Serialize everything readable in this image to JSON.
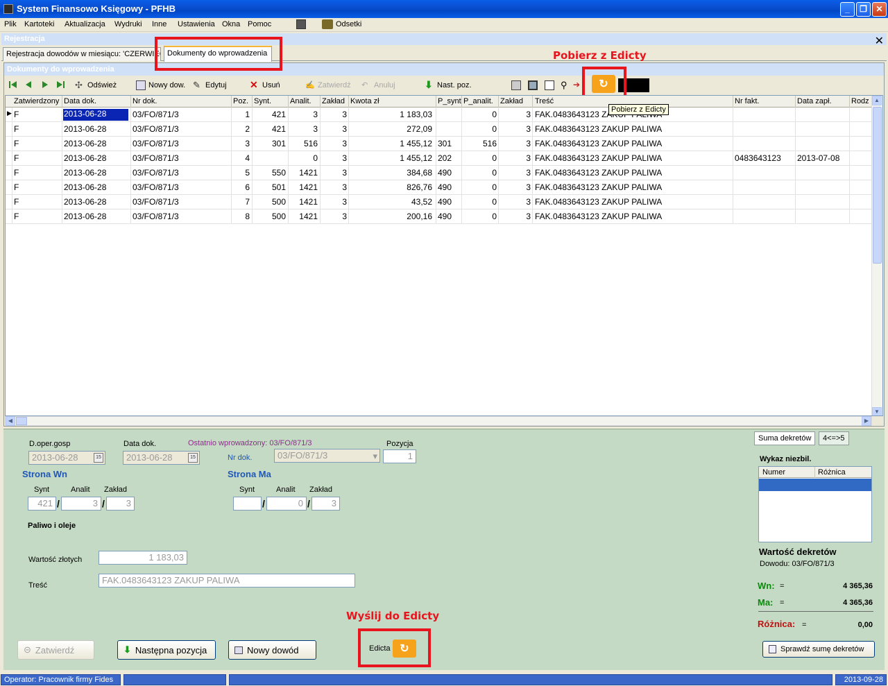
{
  "window": {
    "title": "System Finansowo Księgowy - PFHB"
  },
  "menu": [
    "Plik",
    "Kartoteki",
    "Aktualizacja",
    "Wydruki",
    "Inne",
    "Ustawienia",
    "Okna",
    "Pomoc"
  ],
  "menu_extra": {
    "odsetki": "Odsetki"
  },
  "child": {
    "title": "Rejestracja"
  },
  "tabs": [
    {
      "label": "Rejestracja dowodów w miesiącu: 'CZERWIEC'"
    },
    {
      "label": "Dokumenty do wprowadzenia"
    }
  ],
  "panel": {
    "title": "Dokumenty do wprowadzenia"
  },
  "toolbar": {
    "refresh": "Odśwież",
    "new_doc": "Nowy dow.",
    "edit": "Edytuj",
    "delete": "Usuń",
    "confirm": "Zatwierdź",
    "cancel": "Anuluj",
    "next_pos": "Nast. poz."
  },
  "annotations": {
    "fetch": "Pobierz z Edicty",
    "send": "Wyślij do Edicty",
    "tooltip": "Pobierz z Edicty"
  },
  "grid": {
    "columns": [
      "Zatwierdzony",
      "Data dok.",
      "Nr dok.",
      "Poz.",
      "Synt.",
      "Analit.",
      "Zakład",
      "Kwota zł",
      "P_synt",
      "P_analit.",
      "Zakład",
      "Treść",
      "Nr fakt.",
      "Data zapł.",
      "Rodz"
    ],
    "rows": [
      [
        "F",
        "2013-06-28",
        "03/FO/871/3",
        "1",
        "421",
        "3",
        "3",
        "1 183,03",
        "",
        "0",
        "3",
        "FAK.0483643123 ZAKUP PALIWA",
        "",
        "",
        ""
      ],
      [
        "F",
        "2013-06-28",
        "03/FO/871/3",
        "2",
        "421",
        "3",
        "3",
        "272,09",
        "",
        "0",
        "3",
        "FAK.0483643123 ZAKUP PALIWA",
        "",
        "",
        ""
      ],
      [
        "F",
        "2013-06-28",
        "03/FO/871/3",
        "3",
        "301",
        "516",
        "3",
        "1 455,12",
        "301",
        "516",
        "3",
        "FAK.0483643123 ZAKUP PALIWA",
        "",
        "",
        ""
      ],
      [
        "F",
        "2013-06-28",
        "03/FO/871/3",
        "4",
        "",
        "0",
        "3",
        "1 455,12",
        "202",
        "0",
        "3",
        "FAK.0483643123 ZAKUP PALIWA",
        "0483643123",
        "2013-07-08",
        ""
      ],
      [
        "F",
        "2013-06-28",
        "03/FO/871/3",
        "5",
        "550",
        "1421",
        "3",
        "384,68",
        "490",
        "0",
        "3",
        "FAK.0483643123 ZAKUP PALIWA",
        "",
        "",
        ""
      ],
      [
        "F",
        "2013-06-28",
        "03/FO/871/3",
        "6",
        "501",
        "1421",
        "3",
        "826,76",
        "490",
        "0",
        "3",
        "FAK.0483643123 ZAKUP PALIWA",
        "",
        "",
        ""
      ],
      [
        "F",
        "2013-06-28",
        "03/FO/871/3",
        "7",
        "500",
        "1421",
        "3",
        "43,52",
        "490",
        "0",
        "3",
        "FAK.0483643123 ZAKUP PALIWA",
        "",
        "",
        ""
      ],
      [
        "F",
        "2013-06-28",
        "03/FO/871/3",
        "8",
        "500",
        "1421",
        "3",
        "200,16",
        "490",
        "0",
        "3",
        "FAK.0483643123 ZAKUP PALIWA",
        "",
        "",
        ""
      ]
    ]
  },
  "form": {
    "doper_label": "D.oper.gosp",
    "doper_value": "2013-06-28",
    "datadok_label": "Data dok.",
    "datadok_value": "2013-06-28",
    "last_entered": "Ostatnio wprowadzony: 03/FO/871/3",
    "nrdok_label": "Nr dok.",
    "nrdok_value": "03/FO/871/3",
    "pozycja_label": "Pozycja",
    "pozycja_value": "1",
    "wn_title": "Strona Wn",
    "ma_title": "Strona Ma",
    "synt_label": "Synt",
    "analit_label": "Analit",
    "zaklad_label": "Zakład",
    "wn_synt": "421",
    "wn_analit": "3",
    "wn_zaklad": "3",
    "ma_synt": "",
    "ma_analit": "0",
    "ma_zaklad": "3",
    "account_name": "Paliwo i oleje",
    "wartosc_label": "Wartość złotych",
    "wartosc_value": "1 183,03",
    "tresc_label": "Treść",
    "tresc_value": "FAK.0483643123 ZAKUP PALIWA",
    "btn_confirm": "Zatwierdź",
    "btn_next": "Następna pozycja",
    "btn_new": "Nowy dowód",
    "edicta_label": "Edicta"
  },
  "summary": {
    "tab1": "Suma dekretów",
    "tab2": "4<=>5",
    "wykaz_title": "Wykaz niezbil.",
    "col_numer": "Numer",
    "col_roznica": "Różnica",
    "wartosc_title": "Wartość dekretów",
    "dowodu": "Dowodu: 03/FO/871/3",
    "wn_label": "Wn:",
    "wn_value": "4 365,36",
    "ma_label": "Ma:",
    "ma_value": "4 365,36",
    "roznica_label": "Różnica:",
    "roznica_value": "0,00",
    "eq": "=",
    "check_btn": "Sprawdź sumę dekretów"
  },
  "status": {
    "operator": "Operator: Pracownik firmy Fides",
    "date": "2013-09-28"
  },
  "colors": {
    "accent_red": "#e8141e",
    "edicta_orange": "#f7a21b",
    "form_green": "#c5dac4"
  }
}
